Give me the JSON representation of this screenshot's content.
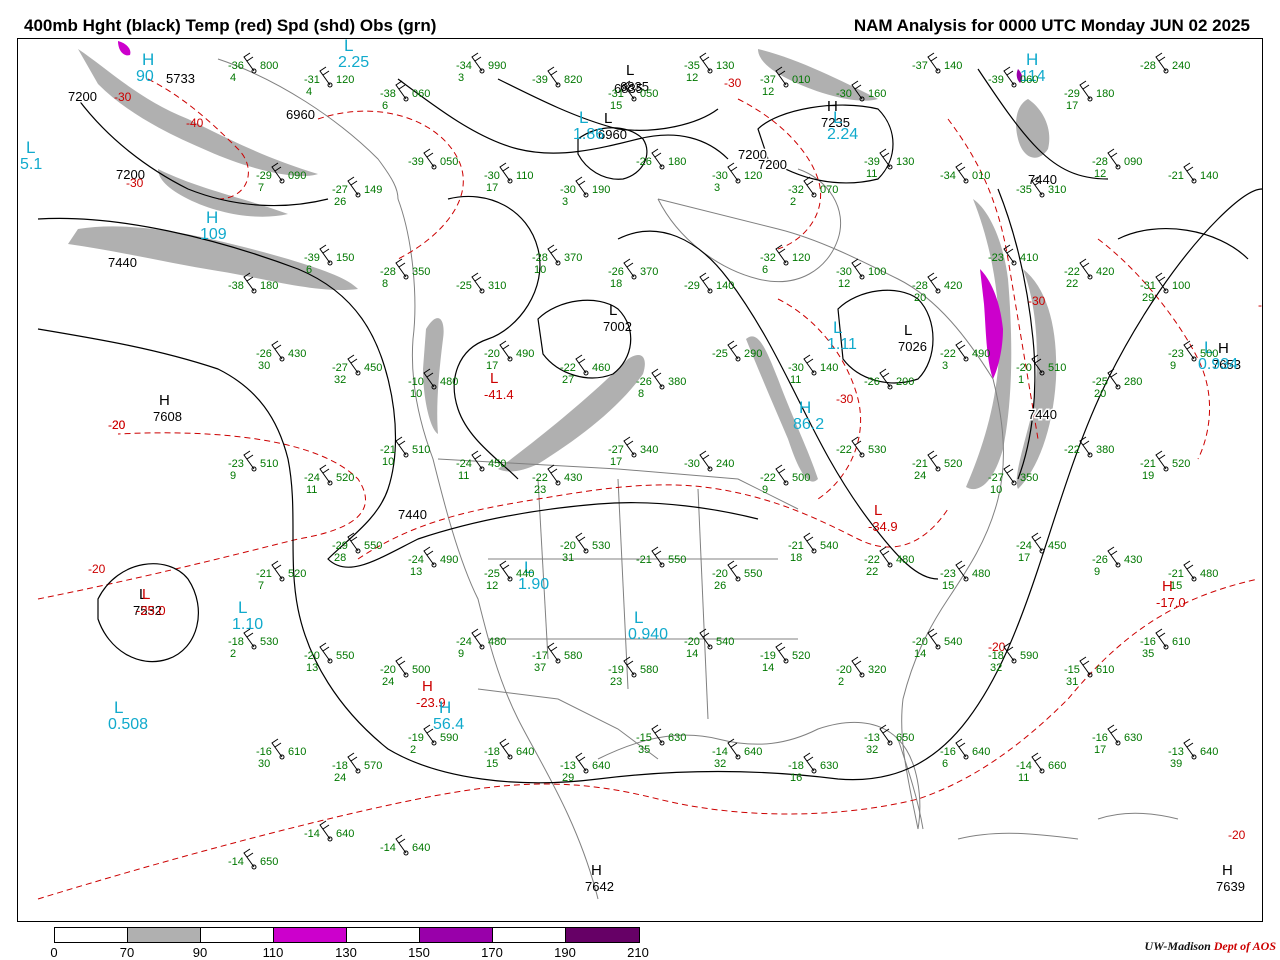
{
  "header": {
    "title_left": "400mb Hght (black) Temp (red) Spd (shd) Obs (grn)",
    "title_right": "NAM Analysis for 0000 UTC Monday  JUN 02 2025"
  },
  "colors": {
    "height_contour": "#000000",
    "temperature_contour": "#cc0000",
    "observation": "#007700",
    "speed_label": "#11aacc",
    "map_border": "#808080"
  },
  "colorbar": {
    "segments": [
      {
        "from": 0,
        "to": 70,
        "color": "#ffffff"
      },
      {
        "from": 70,
        "to": 90,
        "color": "#b0b0b0"
      },
      {
        "from": 90,
        "to": 110,
        "color": "#ffffff"
      },
      {
        "from": 110,
        "to": 130,
        "color": "#cc00cc"
      },
      {
        "from": 130,
        "to": 150,
        "color": "#ffffff"
      },
      {
        "from": 150,
        "to": 170,
        "color": "#9900aa"
      },
      {
        "from": 170,
        "to": 190,
        "color": "#ffffff"
      },
      {
        "from": 190,
        "to": 210,
        "color": "#660066"
      }
    ],
    "labels": [
      "0",
      "70",
      "90",
      "110",
      "130",
      "150",
      "170",
      "190",
      "210"
    ]
  },
  "credit": {
    "org": "UW-Madison",
    "dept": "Dept of AOS"
  },
  "height_labels": [
    "7200",
    "7200",
    "7440",
    "7440",
    "7440",
    "7440",
    "7200",
    "7200",
    "6960",
    "5733",
    "6835"
  ],
  "temperature_labels": [
    "-30",
    "-40",
    "-30",
    "-20",
    "-20",
    "-30",
    "-30",
    "-30",
    "-20",
    "-20",
    "-20",
    "-30"
  ],
  "centers": [
    {
      "type": "H",
      "value": "7608",
      "kind": "height"
    },
    {
      "type": "L",
      "value": "7532",
      "kind": "height"
    },
    {
      "type": "L",
      "value": "7002",
      "kind": "height"
    },
    {
      "type": "H",
      "value": "7235",
      "kind": "height"
    },
    {
      "type": "L",
      "value": "7026",
      "kind": "height"
    },
    {
      "type": "H",
      "value": "7653",
      "kind": "height"
    },
    {
      "type": "H",
      "value": "7639",
      "kind": "height"
    },
    {
      "type": "H",
      "value": "7642",
      "kind": "height"
    },
    {
      "type": "L",
      "value": "6960",
      "kind": "height"
    },
    {
      "type": "L",
      "value": "6835",
      "kind": "height"
    },
    {
      "type": "L",
      "value": "-25.0",
      "kind": "temperature"
    },
    {
      "type": "L",
      "value": "-41.4",
      "kind": "temperature"
    },
    {
      "type": "L",
      "value": "-34.9",
      "kind": "temperature"
    },
    {
      "type": "H",
      "value": "-17.0",
      "kind": "temperature"
    },
    {
      "type": "H",
      "value": "-23.9",
      "kind": "temperature"
    },
    {
      "type": "L",
      "value": "0.508",
      "kind": "speed"
    },
    {
      "type": "L",
      "value": "1.10",
      "kind": "speed"
    },
    {
      "type": "L",
      "value": "1.90",
      "kind": "speed"
    },
    {
      "type": "L",
      "value": "0.940",
      "kind": "speed"
    },
    {
      "type": "L",
      "value": "0.934",
      "kind": "speed"
    },
    {
      "type": "L",
      "value": "1.86",
      "kind": "speed"
    },
    {
      "type": "L",
      "value": "2.24",
      "kind": "speed"
    },
    {
      "type": "L",
      "value": "2.25",
      "kind": "speed"
    },
    {
      "type": "L",
      "value": "1.11",
      "kind": "speed"
    },
    {
      "type": "L",
      "value": "5.1",
      "kind": "speed"
    },
    {
      "type": "H",
      "value": "109",
      "kind": "speed"
    },
    {
      "type": "H",
      "value": "114",
      "kind": "speed"
    },
    {
      "type": "H",
      "value": "90",
      "kind": "speed"
    },
    {
      "type": "H",
      "value": "56.4",
      "kind": "speed"
    },
    {
      "type": "H",
      "value": "86.2",
      "kind": "speed"
    }
  ],
  "observations": [
    {
      "t": "-36",
      "h": "800",
      "d": "4"
    },
    {
      "t": "-31",
      "h": "120",
      "d": "4"
    },
    {
      "t": "-38",
      "h": "060",
      "d": "6"
    },
    {
      "t": "-34",
      "h": "990",
      "d": "3"
    },
    {
      "t": "-39",
      "h": "820",
      "d": ""
    },
    {
      "t": "-31",
      "h": "050",
      "d": "15"
    },
    {
      "t": "-35",
      "h": "130",
      "d": "12"
    },
    {
      "t": "-37",
      "h": "010",
      "d": "12"
    },
    {
      "t": "-30",
      "h": "160",
      "d": ""
    },
    {
      "t": "-37",
      "h": "140",
      "d": ""
    },
    {
      "t": "-39",
      "h": "060",
      "d": ""
    },
    {
      "t": "-29",
      "h": "180",
      "d": "17"
    },
    {
      "t": "-28",
      "h": "240",
      "d": ""
    },
    {
      "t": "-29",
      "h": "090",
      "d": "7"
    },
    {
      "t": "-27",
      "h": "149",
      "d": "26"
    },
    {
      "t": "-39",
      "h": "050",
      "d": ""
    },
    {
      "t": "-30",
      "h": "110",
      "d": "17"
    },
    {
      "t": "-30",
      "h": "190",
      "d": "3"
    },
    {
      "t": "-26",
      "h": "180",
      "d": ""
    },
    {
      "t": "-30",
      "h": "120",
      "d": "3"
    },
    {
      "t": "-32",
      "h": "070",
      "d": "2"
    },
    {
      "t": "-39",
      "h": "130",
      "d": "11"
    },
    {
      "t": "-34",
      "h": "010",
      "d": ""
    },
    {
      "t": "-35",
      "h": "310",
      "d": ""
    },
    {
      "t": "-28",
      "h": "090",
      "d": "12"
    },
    {
      "t": "-21",
      "h": "140",
      "d": ""
    },
    {
      "t": "-38",
      "h": "180",
      "d": ""
    },
    {
      "t": "-39",
      "h": "150",
      "d": "6"
    },
    {
      "t": "-28",
      "h": "350",
      "d": "8"
    },
    {
      "t": "-25",
      "h": "310",
      "d": ""
    },
    {
      "t": "-28",
      "h": "370",
      "d": "10"
    },
    {
      "t": "-26",
      "h": "370",
      "d": "18"
    },
    {
      "t": "-29",
      "h": "140",
      "d": ""
    },
    {
      "t": "-32",
      "h": "120",
      "d": "6"
    },
    {
      "t": "-30",
      "h": "100",
      "d": "12"
    },
    {
      "t": "-28",
      "h": "420",
      "d": "20"
    },
    {
      "t": "-23",
      "h": "410",
      "d": ""
    },
    {
      "t": "-22",
      "h": "420",
      "d": "22"
    },
    {
      "t": "-31",
      "h": "100",
      "d": "29"
    },
    {
      "t": "-26",
      "h": "430",
      "d": "30"
    },
    {
      "t": "-27",
      "h": "450",
      "d": "32"
    },
    {
      "t": "-10",
      "h": "480",
      "d": "10"
    },
    {
      "t": "-20",
      "h": "490",
      "d": "17"
    },
    {
      "t": "-22",
      "h": "460",
      "d": "27"
    },
    {
      "t": "-26",
      "h": "380",
      "d": "8"
    },
    {
      "t": "-25",
      "h": "290",
      "d": ""
    },
    {
      "t": "-30",
      "h": "140",
      "d": "11"
    },
    {
      "t": "-26",
      "h": "200",
      "d": ""
    },
    {
      "t": "-22",
      "h": "490",
      "d": "3"
    },
    {
      "t": "-20",
      "h": "510",
      "d": "1"
    },
    {
      "t": "-25",
      "h": "280",
      "d": "20"
    },
    {
      "t": "-23",
      "h": "500",
      "d": "9"
    },
    {
      "t": "-23",
      "h": "510",
      "d": "9"
    },
    {
      "t": "-24",
      "h": "520",
      "d": "11"
    },
    {
      "t": "-21",
      "h": "510",
      "d": "10"
    },
    {
      "t": "-24",
      "h": "450",
      "d": "11"
    },
    {
      "t": "-22",
      "h": "430",
      "d": "23"
    },
    {
      "t": "-27",
      "h": "340",
      "d": "17"
    },
    {
      "t": "-30",
      "h": "240",
      "d": ""
    },
    {
      "t": "-22",
      "h": "500",
      "d": "9"
    },
    {
      "t": "-22",
      "h": "530",
      "d": ""
    },
    {
      "t": "-21",
      "h": "520",
      "d": "24"
    },
    {
      "t": "-27",
      "h": "350",
      "d": "10"
    },
    {
      "t": "-22",
      "h": "380",
      "d": ""
    },
    {
      "t": "-21",
      "h": "520",
      "d": "19"
    },
    {
      "t": "-21",
      "h": "520",
      "d": "7"
    },
    {
      "t": "-29",
      "h": "550",
      "d": "28"
    },
    {
      "t": "-24",
      "h": "490",
      "d": "13"
    },
    {
      "t": "-25",
      "h": "440",
      "d": "12"
    },
    {
      "t": "-20",
      "h": "530",
      "d": "31"
    },
    {
      "t": "-21",
      "h": "550",
      "d": ""
    },
    {
      "t": "-20",
      "h": "550",
      "d": "26"
    },
    {
      "t": "-21",
      "h": "540",
      "d": "18"
    },
    {
      "t": "-22",
      "h": "480",
      "d": "22"
    },
    {
      "t": "-23",
      "h": "480",
      "d": "15"
    },
    {
      "t": "-24",
      "h": "450",
      "d": "17"
    },
    {
      "t": "-26",
      "h": "430",
      "d": "9"
    },
    {
      "t": "-21",
      "h": "480",
      "d": "15"
    },
    {
      "t": "-18",
      "h": "530",
      "d": "2"
    },
    {
      "t": "-20",
      "h": "550",
      "d": "13"
    },
    {
      "t": "-20",
      "h": "500",
      "d": "24"
    },
    {
      "t": "-24",
      "h": "480",
      "d": "9"
    },
    {
      "t": "-17",
      "h": "580",
      "d": "37"
    },
    {
      "t": "-19",
      "h": "580",
      "d": "23"
    },
    {
      "t": "-20",
      "h": "540",
      "d": "14"
    },
    {
      "t": "-19",
      "h": "520",
      "d": "14"
    },
    {
      "t": "-20",
      "h": "320",
      "d": "2"
    },
    {
      "t": "-20",
      "h": "540",
      "d": "14"
    },
    {
      "t": "-18",
      "h": "590",
      "d": "32"
    },
    {
      "t": "-15",
      "h": "610",
      "d": "31"
    },
    {
      "t": "-16",
      "h": "610",
      "d": "35"
    },
    {
      "t": "-16",
      "h": "610",
      "d": "30"
    },
    {
      "t": "-18",
      "h": "570",
      "d": "24"
    },
    {
      "t": "-19",
      "h": "590",
      "d": "2"
    },
    {
      "t": "-18",
      "h": "640",
      "d": "15"
    },
    {
      "t": "-13",
      "h": "640",
      "d": "29"
    },
    {
      "t": "-15",
      "h": "630",
      "d": "35"
    },
    {
      "t": "-14",
      "h": "640",
      "d": "32"
    },
    {
      "t": "-18",
      "h": "630",
      "d": "16"
    },
    {
      "t": "-13",
      "h": "650",
      "d": "32"
    },
    {
      "t": "-16",
      "h": "640",
      "d": "6"
    },
    {
      "t": "-14",
      "h": "660",
      "d": "11"
    },
    {
      "t": "-16",
      "h": "630",
      "d": "17"
    },
    {
      "t": "-13",
      "h": "640",
      "d": "39"
    },
    {
      "t": "-14",
      "h": "650",
      "d": ""
    },
    {
      "t": "-14",
      "h": "640",
      "d": ""
    },
    {
      "t": "-14",
      "h": "640",
      "d": ""
    }
  ]
}
